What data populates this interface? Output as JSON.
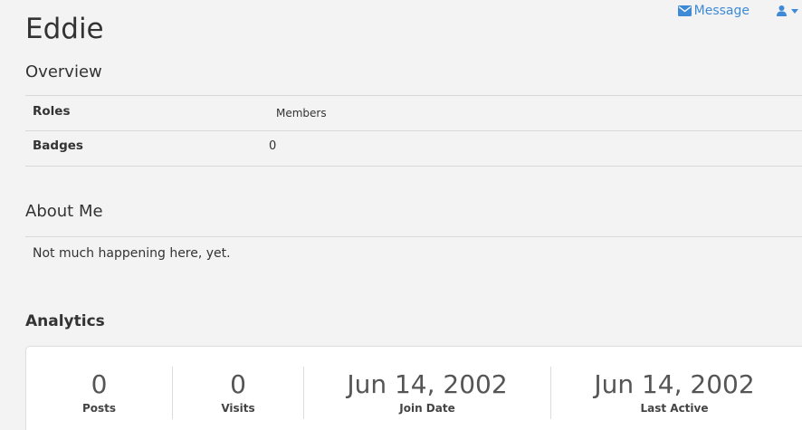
{
  "header": {
    "message_label": "Message",
    "message_icon": "envelope-icon",
    "user_icon": "user-icon",
    "accent_color": "#3f8ad6"
  },
  "profile": {
    "name": "Eddie"
  },
  "overview": {
    "title": "Overview",
    "rows": [
      {
        "label": "Roles",
        "value": "Members"
      },
      {
        "label": "Badges",
        "value": "0"
      }
    ]
  },
  "about": {
    "title": "About Me",
    "text": "Not much happening here, yet."
  },
  "analytics": {
    "title": "Analytics",
    "stats": [
      {
        "value": "0",
        "label": "Posts"
      },
      {
        "value": "0",
        "label": "Visits"
      },
      {
        "value": "Jun 14, 2002",
        "label": "Join Date"
      },
      {
        "value": "Jun 14, 2002",
        "label": "Last Active"
      }
    ]
  }
}
